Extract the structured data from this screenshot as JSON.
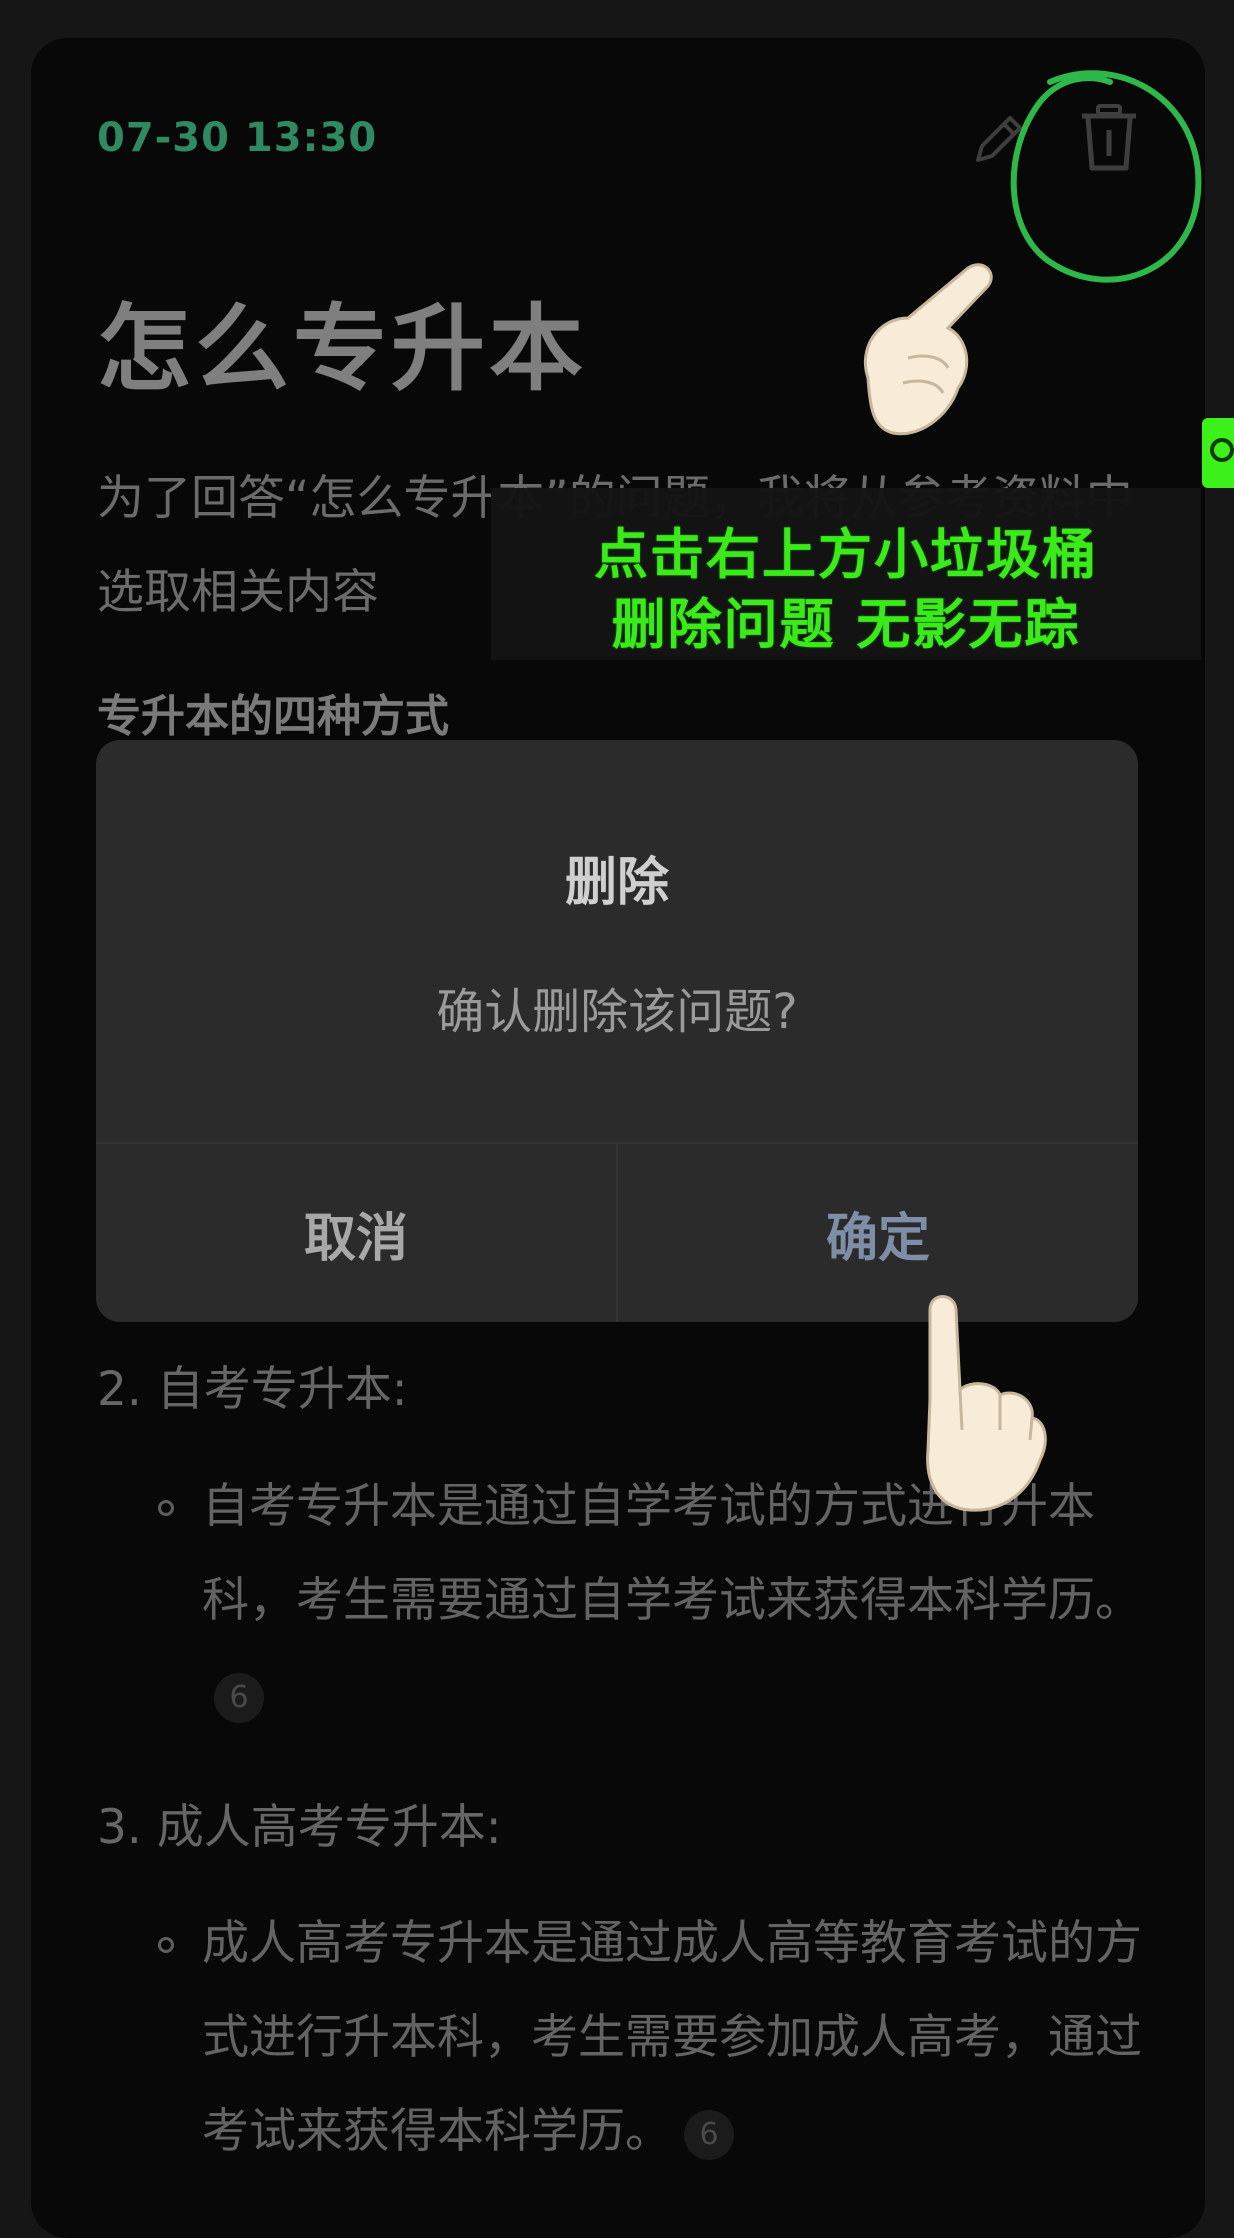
{
  "header": {
    "timestamp": "07-30 13:30",
    "edit_icon": "pencil-icon",
    "delete_icon": "trash-icon"
  },
  "article": {
    "title": "怎么专升本",
    "intro": "为了回答“怎么专升本”的问题，我将从参考资料中选取相关内容",
    "section_heading": "专升本的四种方式",
    "items": [
      {
        "number": "2. 自考专升本:",
        "bullet": "自考专升本是通过自学考试的方式进行升本科，考生需要通过自学考试来获得本科学历。",
        "citation": "6"
      },
      {
        "number": "3. 成人高考专升本:",
        "bullet": "成人高考专升本是通过成人高等教育考试的方式进行升本科，考生需要参加成人高考，通过考试来获得本科学历。",
        "citation": "6"
      }
    ]
  },
  "dialog": {
    "title": "删除",
    "message": "确认删除该问题?",
    "cancel_label": "取消",
    "confirm_label": "确定"
  },
  "annotation": {
    "line1": "点击右上方小垃圾桶",
    "line2": "删除问题 无影无踪",
    "color": "#3cf21a"
  },
  "colors": {
    "accent_green": "#2f8a64",
    "confirm_blue": "#7d8ea6"
  }
}
